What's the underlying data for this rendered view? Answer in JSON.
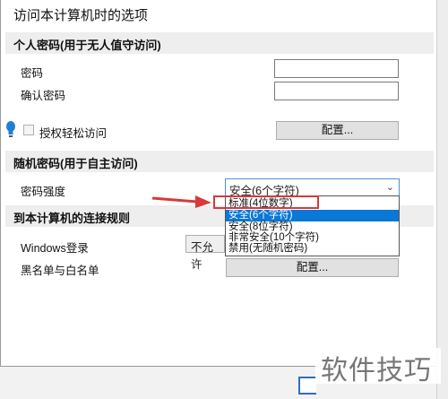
{
  "dialog": {
    "title": "访问本计算机时的选项"
  },
  "personal_password": {
    "heading": "个人密码(用于无人值守访问)",
    "password_label": "密码",
    "password_value": "",
    "confirm_label": "确认密码",
    "confirm_value": "",
    "easy_access_label": "授权轻松访问",
    "easy_access_checked": false,
    "configure_button": "配置..."
  },
  "random_password": {
    "heading": "随机密码(用于自主访问)",
    "strength_label": "密码强度",
    "strength_selected": "安全(6个字符)",
    "strength_options": [
      "标准(4位数字)",
      "安全(6个字符)",
      "安全(8位字符)",
      "非常安全(10个字符)",
      "禁用(无随机密码)"
    ],
    "highlighted_option_index": 1,
    "annotated_option_index": 0
  },
  "connection_rules": {
    "heading": "到本计算机的连接规则",
    "windows_login_label": "Windows登录",
    "windows_login_value": "不允许",
    "blacklist_label": "黑名单与白名单",
    "configure_button": "配置..."
  },
  "watermark": {
    "text": "软件技巧"
  },
  "colors": {
    "selection": "#0a78d7",
    "annotation_red": "#d73a3a",
    "section_bg": "#eeeeee"
  },
  "icons": {
    "bulb": "lightbulb-icon",
    "dropdown": "chevron-down-icon",
    "annotation": "red-arrow-icon"
  }
}
